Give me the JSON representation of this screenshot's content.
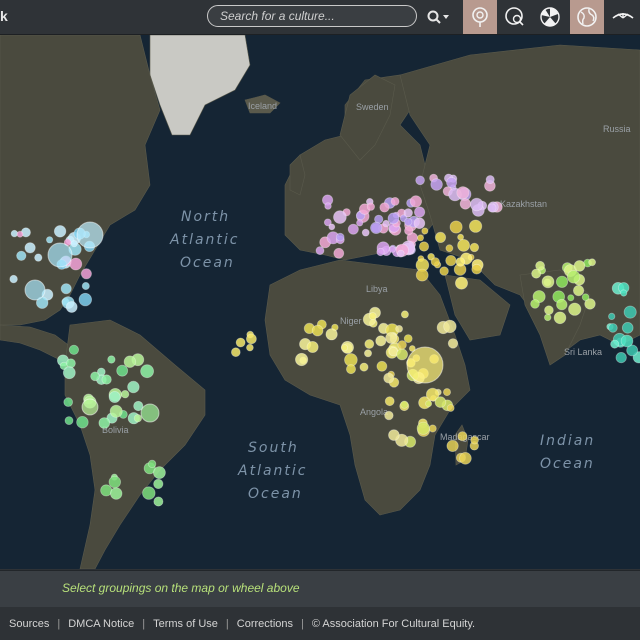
{
  "header": {
    "brand_fragment": "k",
    "search_placeholder": "Search for a culture...",
    "tools": [
      {
        "name": "pin-tool",
        "active": true
      },
      {
        "name": "globe-search-tool",
        "active": false
      },
      {
        "name": "wheel-tool",
        "active": false
      },
      {
        "name": "globe-tool",
        "active": true
      },
      {
        "name": "eye-tool",
        "active": false
      }
    ]
  },
  "map": {
    "ocean_labels": {
      "north_atlantic": [
        "North",
        "Atlantic",
        "Ocean"
      ],
      "south_atlantic": [
        "South",
        "Atlantic",
        "Ocean"
      ],
      "indian": [
        "Indian",
        "Ocean"
      ]
    },
    "place_labels": {
      "iceland": "Iceland",
      "sweden": "Sweden",
      "russia": "Russia",
      "kazakhstan": "Kazakhstan",
      "libya": "Libya",
      "niger": "Niger",
      "sri_lanka": "Sri Lanka",
      "bolivia": "Bolivia",
      "madagascar": "Madagascar",
      "angola": "Angola"
    }
  },
  "status": {
    "hint": "Select groupings on the map or wheel above"
  },
  "footer": {
    "links": [
      "Sources",
      "DMCA Notice",
      "Terms of Use",
      "Corrections"
    ],
    "copyright": "© Association For Cultural Equity."
  }
}
